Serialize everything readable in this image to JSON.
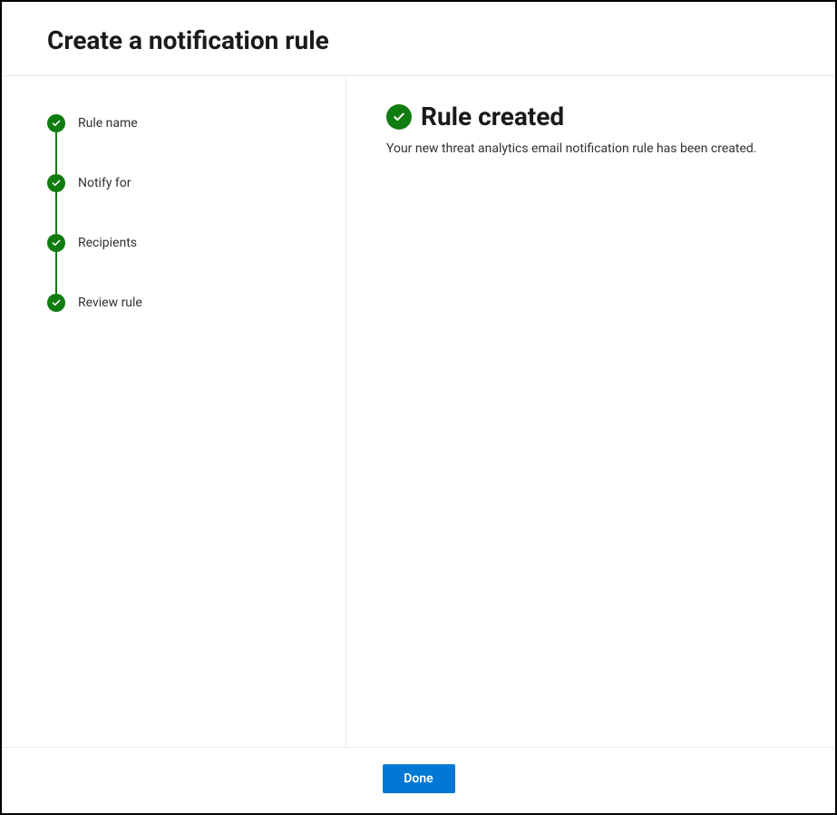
{
  "header": {
    "title": "Create a notification rule"
  },
  "sidebar": {
    "steps": [
      {
        "label": "Rule name",
        "status": "complete"
      },
      {
        "label": "Notify for",
        "status": "complete"
      },
      {
        "label": "Recipients",
        "status": "complete"
      },
      {
        "label": "Review rule",
        "status": "complete"
      }
    ]
  },
  "main": {
    "result_title": "Rule created",
    "result_description": "Your new threat analytics email notification rule has been created."
  },
  "footer": {
    "done_label": "Done"
  },
  "colors": {
    "success": "#107c10",
    "primary": "#0078d4"
  }
}
